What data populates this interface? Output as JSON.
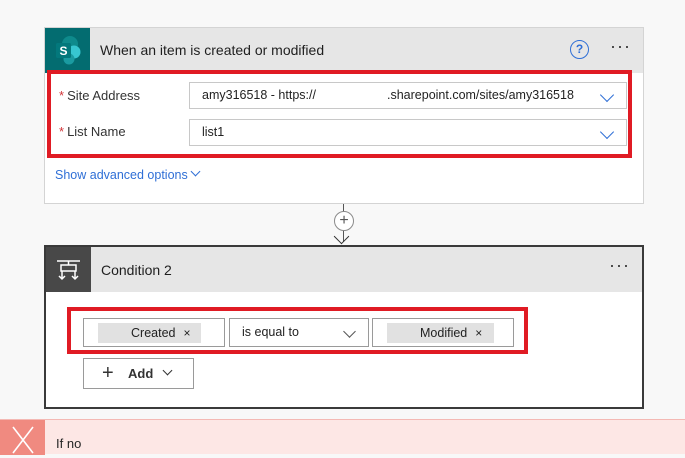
{
  "trigger": {
    "title": "When an item is created or modified",
    "icon": "sharepoint-icon",
    "help_glyph": "?",
    "more_glyph": "···",
    "fields": [
      {
        "label": "Site Address",
        "required_mark": "*",
        "value_prefix": "amy316518 - https://",
        "value_suffix": ".sharepoint.com/sites/amy316518"
      },
      {
        "label": "List Name",
        "required_mark": "*",
        "value": "list1"
      }
    ],
    "advanced_options_label": "Show advanced options"
  },
  "connector": {
    "add_glyph": "+"
  },
  "condition": {
    "title": "Condition 2",
    "icon": "condition-icon",
    "more_glyph": "···",
    "left_token": "Created",
    "operator": "is equal to",
    "right_token": "Modified",
    "token_remove_glyph": "×",
    "add_button": {
      "plus_glyph": "+",
      "label": "Add"
    }
  },
  "if_no": {
    "label": "If no",
    "icon": "close-icon"
  },
  "colors": {
    "sharepoint_teal": "#036c70",
    "accent_blue": "#2f6fd6",
    "highlight_red": "#e01b24",
    "if_no_bg": "#fde7e5",
    "if_no_icon_bg": "#f08a80"
  }
}
